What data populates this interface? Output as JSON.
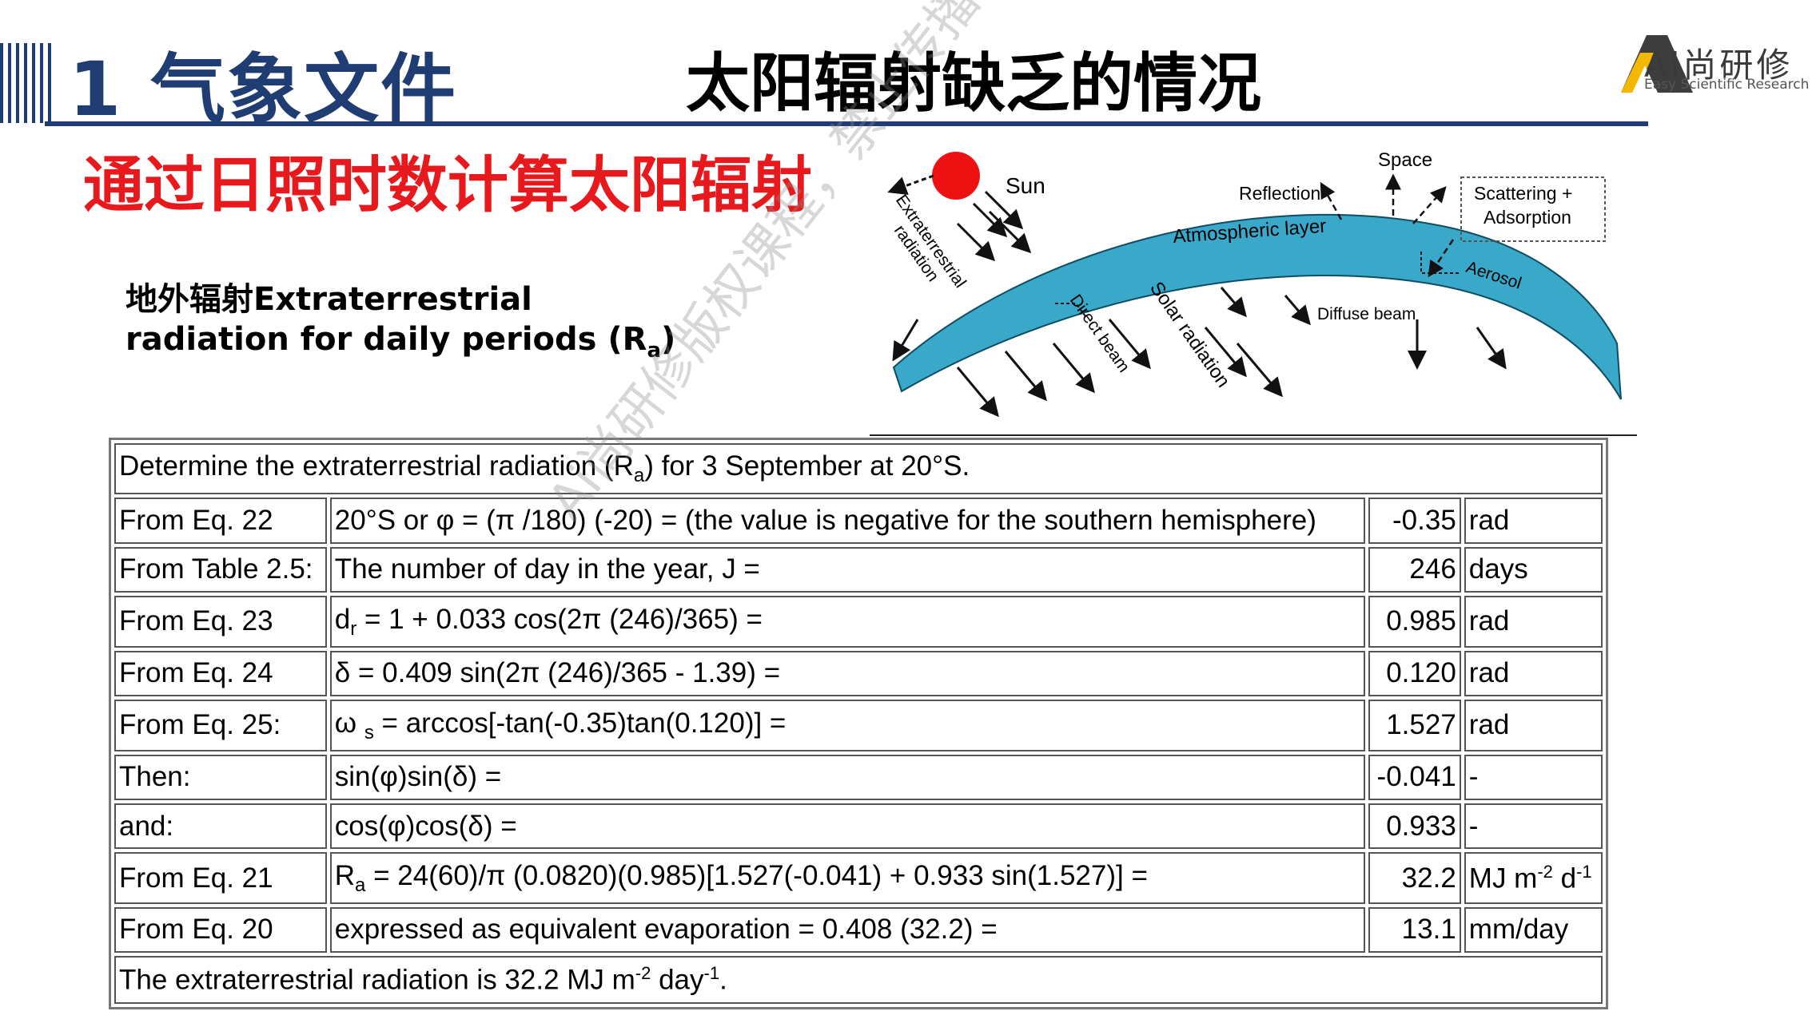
{
  "header": {
    "section_title": "1 气象文件",
    "page_title": "太阳辐射缺乏的情况",
    "logo_text": "Ai尚研修",
    "logo_subtitle": "Easy Scientific Research"
  },
  "red_heading": "通过日照时数计算太阳辐射",
  "sub_heading": {
    "line1": "地外辐射Extraterrestrial",
    "line2_prefix": "radiation for daily periods (R",
    "line2_sub": "a",
    "line2_suffix": ")"
  },
  "diagram": {
    "sun": "Sun",
    "space": "Space",
    "reflection": "Reflection",
    "scattering_line1": "Scattering +",
    "scattering_line2": "Adsorption",
    "atmospheric_layer": "Atmospheric layer",
    "extraterrestrial_line1": "Extraterrestrial",
    "extraterrestrial_line2": "radiation",
    "aerosol": "Aerosol",
    "diffuse_beam": "Diffuse beam",
    "direct_beam": "Direct beam",
    "solar_radiation": "Solar radiation"
  },
  "table": {
    "title_prefix": "Determine the extraterrestrial radiation (R",
    "title_sub": "a",
    "title_suffix": ") for 3 September at 20°S.",
    "rows": [
      {
        "source": "From Eq. 22",
        "formula": "20°S or φ = (π /180) (-20) = (the value is negative for the southern hemisphere)",
        "value": "-0.35",
        "unit": "rad"
      },
      {
        "source": "From Table 2.5:",
        "formula": "The number of day in the year, J =",
        "value": "246",
        "unit": "days"
      },
      {
        "source": "From Eq. 23",
        "formula_pre": "d",
        "formula_sub": "r",
        "formula_post": " = 1 + 0.033 cos(2π (246)/365) =",
        "value": "0.985",
        "unit": "rad"
      },
      {
        "source": "From Eq. 24",
        "formula": "δ = 0.409 sin(2π (246)/365 - 1.39) =",
        "value": "0.120",
        "unit": "rad"
      },
      {
        "source": "From Eq. 25:",
        "formula_pre": "ω ",
        "formula_sub": "s",
        "formula_post": " = arccos[-tan(-0.35)tan(0.120)] =",
        "value": "1.527",
        "unit": "rad"
      },
      {
        "source": "Then:",
        "formula": "sin(φ)sin(δ) =",
        "value": "-0.041",
        "unit": "-"
      },
      {
        "source": "and:",
        "formula": "cos(φ)cos(δ) =",
        "value": "0.933",
        "unit": "-"
      },
      {
        "source": "From Eq. 21",
        "formula_pre": "R",
        "formula_sub": "a",
        "formula_post": " = 24(60)/π (0.0820)(0.985)[1.527(-0.041) + 0.933 sin(1.527)] =",
        "value": "32.2",
        "unit_a": "MJ m",
        "unit_sup1": "-2",
        "unit_b": " d",
        "unit_sup2": "-1"
      },
      {
        "source": "From Eq. 20",
        "formula": "expressed as equivalent evaporation = 0.408 (32.2) =",
        "value": "13.1",
        "unit": "mm/day"
      }
    ],
    "footer_a": "The extraterrestrial radiation is 32.2 MJ m",
    "footer_sup1": "-2",
    "footer_b": " day",
    "footer_sup2": "-1",
    "footer_c": "."
  },
  "watermark": "Ai尚研修版权课程，禁止传播",
  "colors": {
    "navy": "#1f3c73",
    "red_heading": "#e8191d",
    "atmosphere": "#3aa8c8",
    "sun": "#ee1111",
    "logo_gold": "#f5b800"
  }
}
